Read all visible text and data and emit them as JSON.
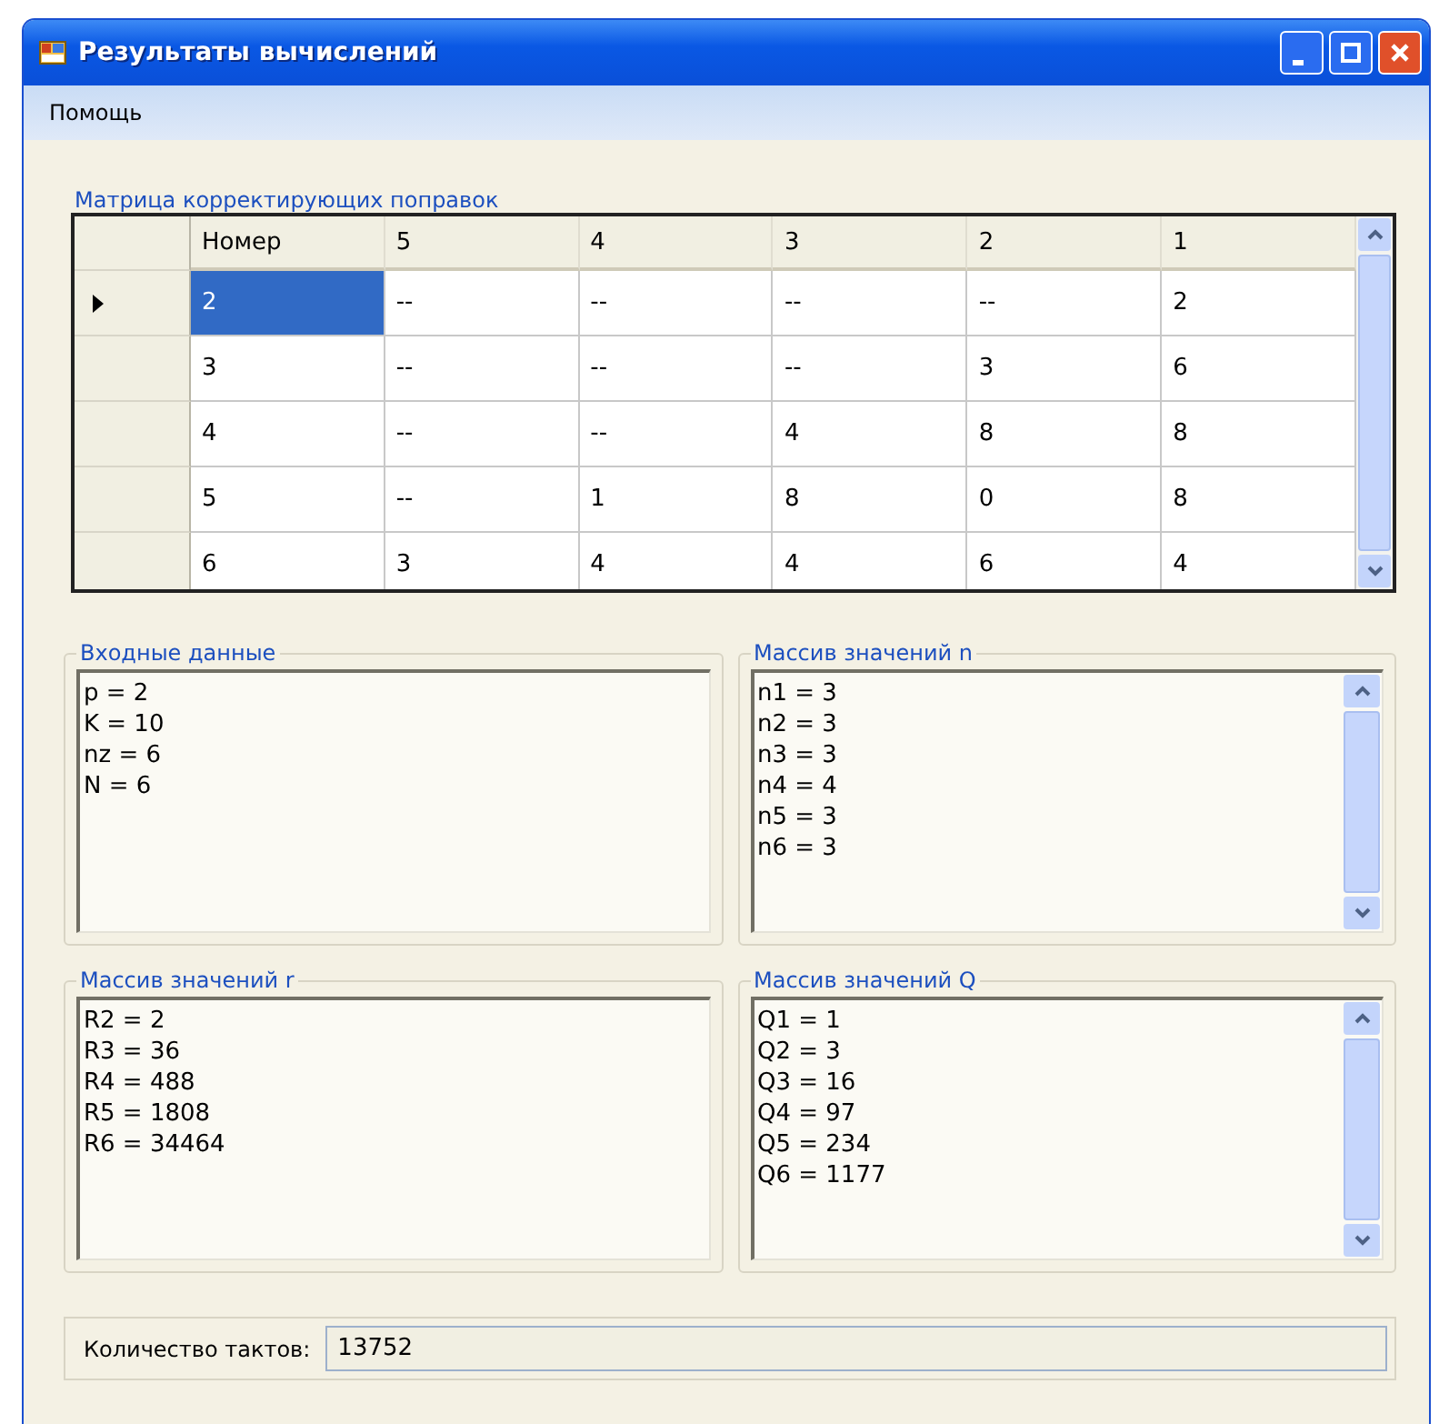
{
  "window": {
    "title": "Результаты вычислений"
  },
  "menu": [
    "Помощь"
  ],
  "matrix": {
    "title": "Матрица корректирующих поправок",
    "columns": [
      "Номер",
      "5",
      "4",
      "3",
      "2",
      "1"
    ],
    "rows": [
      {
        "selected": true,
        "cells": [
          "2",
          "--",
          "--",
          "--",
          "--",
          "2"
        ]
      },
      {
        "selected": false,
        "cells": [
          "3",
          "--",
          "--",
          "--",
          "3",
          "6"
        ]
      },
      {
        "selected": false,
        "cells": [
          "4",
          "--",
          "--",
          "4",
          "8",
          "8"
        ]
      },
      {
        "selected": false,
        "cells": [
          "5",
          "--",
          "1",
          "8",
          "0",
          "8"
        ]
      },
      {
        "selected": false,
        "cells": [
          "6",
          "3",
          "4",
          "4",
          "6",
          "4"
        ]
      }
    ]
  },
  "panels": [
    {
      "title": "Входные данные",
      "scrollbar": false,
      "lines": [
        "p = 2",
        "K = 10",
        "nz = 6",
        "N = 6"
      ]
    },
    {
      "title": "Массив значений n",
      "scrollbar": true,
      "lines": [
        "n1 = 3",
        "n2 = 3",
        "n3 = 3",
        "n4 = 4",
        "n5 = 3",
        "n6 = 3"
      ]
    },
    {
      "title": "Массив значений r",
      "scrollbar": false,
      "lines": [
        "R2 = 2",
        "R3 = 36",
        "R4 = 488",
        "R5 = 1808",
        "R6 = 34464"
      ]
    },
    {
      "title": "Массив значений Q",
      "scrollbar": true,
      "lines": [
        "Q1 = 1",
        "Q2 = 3",
        "Q3 = 16",
        "Q4 = 97",
        "Q5 = 234",
        "Q6 = 1177"
      ]
    }
  ],
  "footer": {
    "label": "Количество тактов:",
    "value": "13752"
  }
}
